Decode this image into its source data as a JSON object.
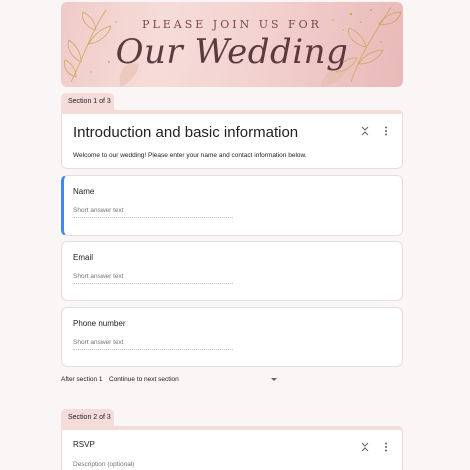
{
  "banner": {
    "kicker": "PLEASE JOIN US FOR",
    "title": "Our Wedding"
  },
  "section1": {
    "tab_label": "Section 1 of 3",
    "title": "Introduction and basic information",
    "description": "Welcome to our wedding! Please enter your name and contact information below."
  },
  "questions": [
    {
      "title": "Name",
      "placeholder": "Short answer text"
    },
    {
      "title": "Email",
      "placeholder": "Short answer text"
    },
    {
      "title": "Phone number",
      "placeholder": "Short answer text"
    }
  ],
  "after_section": {
    "label": "After section 1",
    "selected": "Continue to next section"
  },
  "section2": {
    "tab_label": "Section 2 of 3",
    "title": "RSVP",
    "description_placeholder": "Description (optional)"
  },
  "colors": {
    "accent": "#4285f4",
    "section_tab": "#f6dcd9",
    "background": "#faf6f5"
  },
  "icons": [
    "collapse-icon",
    "more-vert-icon",
    "dropdown-caret-icon"
  ]
}
